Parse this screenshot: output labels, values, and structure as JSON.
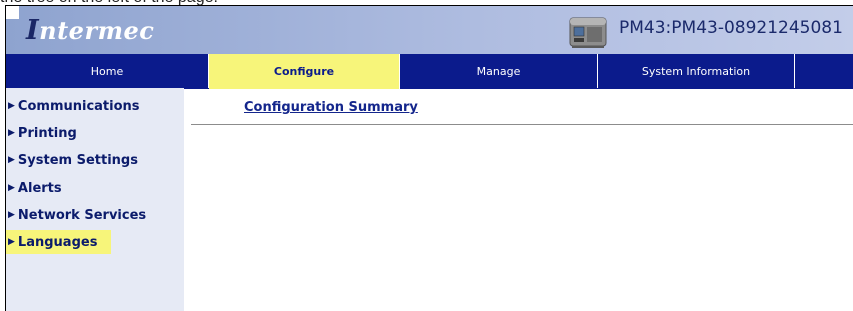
{
  "caption": "the tree on the left of the page.",
  "header": {
    "logo_text": "ntermec",
    "logo_mark": "I",
    "device_name": "PM43:PM43-08921245081",
    "printer_icon": "printer-icon"
  },
  "nav": {
    "tabs": [
      {
        "label": "Home"
      },
      {
        "label": "Configure"
      },
      {
        "label": "Manage"
      },
      {
        "label": "System Information"
      }
    ],
    "active_tab": "Configure"
  },
  "sidebar": {
    "items": [
      {
        "label": "Communications"
      },
      {
        "label": "Printing"
      },
      {
        "label": "System Settings"
      },
      {
        "label": "Alerts"
      },
      {
        "label": "Network Services"
      },
      {
        "label": "Languages"
      }
    ],
    "highlighted_item": "Languages"
  },
  "main": {
    "title_link": "Configuration Summary"
  },
  "colors": {
    "nav_bg": "#0b1b8c",
    "highlight": "#f7f57a",
    "sidebar_bg": "#e6eaf5",
    "header_bg": "#aebce0"
  }
}
